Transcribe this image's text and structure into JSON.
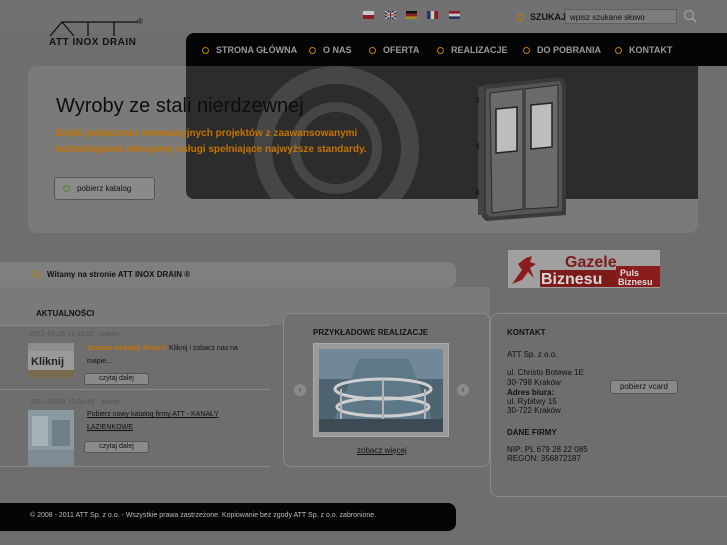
{
  "header": {
    "logo_text": "ATT INOX DRAIN",
    "logo_reg": "®",
    "search_label": "SZUKAJ",
    "search_placeholder": "wpisz szukane słowo",
    "languages": [
      "pl",
      "en",
      "de",
      "fr",
      "nl"
    ]
  },
  "nav": {
    "items": [
      {
        "label": "STRONA GŁÓWNA"
      },
      {
        "label": "O NAS"
      },
      {
        "label": "OFERTA"
      },
      {
        "label": "REALIZACJE"
      },
      {
        "label": "DO POBRANIA"
      },
      {
        "label": "KONTAKT"
      }
    ]
  },
  "hero": {
    "title": "Wyroby ze stali nierdzewnej",
    "subtitle": "Dzięki połączeniu innowacyjnych projektów z zaawansowanymi technologiami oferujemy usługi spełniające najwyższe standardy.",
    "button_label": "pobierz katalog"
  },
  "welcome": {
    "text": "Witamy na stronie ATT INOX DRAIN ®"
  },
  "badge": {
    "line1": "Gazele",
    "line2": "Biznesu",
    "line3": "Puls",
    "line4": "Biznesu"
  },
  "news": {
    "heading": "AKTUALNOŚCI",
    "items": [
      {
        "meta": "2011-04-26 11:40:32 - admin",
        "thumb_text": "Kliknij",
        "title": "Zmiana siedziby firmy!!!",
        "body": " Kliknij i zobacz nas na mapie...",
        "button": "czytaj dalej"
      },
      {
        "meta": "2011-03-09 10:34:45 - admin",
        "title": "Pobierz nowy katalog firmy ATT - KANAŁY ŁAZIENKOWE",
        "button": "czytaj dalej"
      }
    ]
  },
  "realizacje": {
    "heading": "PRZYKŁADOWE REALIZACJE",
    "prev": "‹",
    "next": "›",
    "see_more": "zobacz więcej"
  },
  "contact": {
    "heading": "KONTAKT",
    "company": "ATT Sp. z o.o.",
    "street": "ul. Christo Botewa 1E",
    "city": "30-798 Kraków",
    "office_label": "Adres biura:",
    "office_street": "ul. Rybitwy 15",
    "office_city": "30-722 Kraków",
    "vcard_button": "pobierz vcard",
    "company_data_heading": "DANE FIRMY",
    "nip": "NIP: PL 679 28 22 085",
    "regon": "REGON: 356872187"
  },
  "footer": {
    "text": "© 2008 - 2011 ATT Sp. z o.o. - Wszystkie prawa zastrzeżone. Kopiowanie bez zgody ATT Sp. z o.o. zabronione."
  }
}
